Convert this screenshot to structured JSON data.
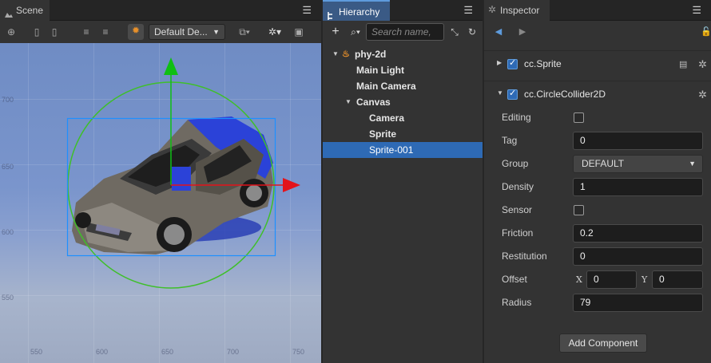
{
  "scene": {
    "tab_label": "Scene",
    "camera_dropdown": "Default De...",
    "ruler_y": [
      "700",
      "650",
      "600",
      "550"
    ],
    "ruler_x": [
      "550",
      "600",
      "650",
      "700",
      "750"
    ]
  },
  "hierarchy": {
    "tab_label": "Hierarchy",
    "search_placeholder": "Search name,",
    "nodes": [
      {
        "label": "phy-2d",
        "expanded": true,
        "level": 0
      },
      {
        "label": "Main Light",
        "level": 1
      },
      {
        "label": "Main Camera",
        "level": 1
      },
      {
        "label": "Canvas",
        "expanded": true,
        "level": 1
      },
      {
        "label": "Camera",
        "level": 2
      },
      {
        "label": "Sprite",
        "level": 2
      },
      {
        "label": "Sprite-001",
        "level": 2,
        "selected": true
      }
    ]
  },
  "inspector": {
    "tab_label": "Inspector",
    "components": [
      {
        "name": "cc.Sprite",
        "enabled": true,
        "expanded": false
      },
      {
        "name": "cc.CircleCollider2D",
        "enabled": true,
        "expanded": true
      }
    ],
    "props": {
      "editing": {
        "label": "Editing",
        "checked": false
      },
      "tag": {
        "label": "Tag",
        "value": "0"
      },
      "group": {
        "label": "Group",
        "value": "DEFAULT"
      },
      "density": {
        "label": "Density",
        "value": "1"
      },
      "sensor": {
        "label": "Sensor",
        "checked": false
      },
      "friction": {
        "label": "Friction",
        "value": "0.2"
      },
      "restitution": {
        "label": "Restitution",
        "value": "0"
      },
      "offset": {
        "label": "Offset",
        "x_label": "X",
        "x": "0",
        "y_label": "Y",
        "y": "0"
      },
      "radius": {
        "label": "Radius",
        "value": "79"
      }
    },
    "add_component": "Add Component"
  },
  "colors": {
    "selection": "#2e6ab5",
    "accent": "#5e9bdc",
    "gizmo_x": "#e3131b",
    "gizmo_y": "#0fbf13",
    "collider": "#3fbf2a",
    "bounds": "#1e90ff"
  }
}
